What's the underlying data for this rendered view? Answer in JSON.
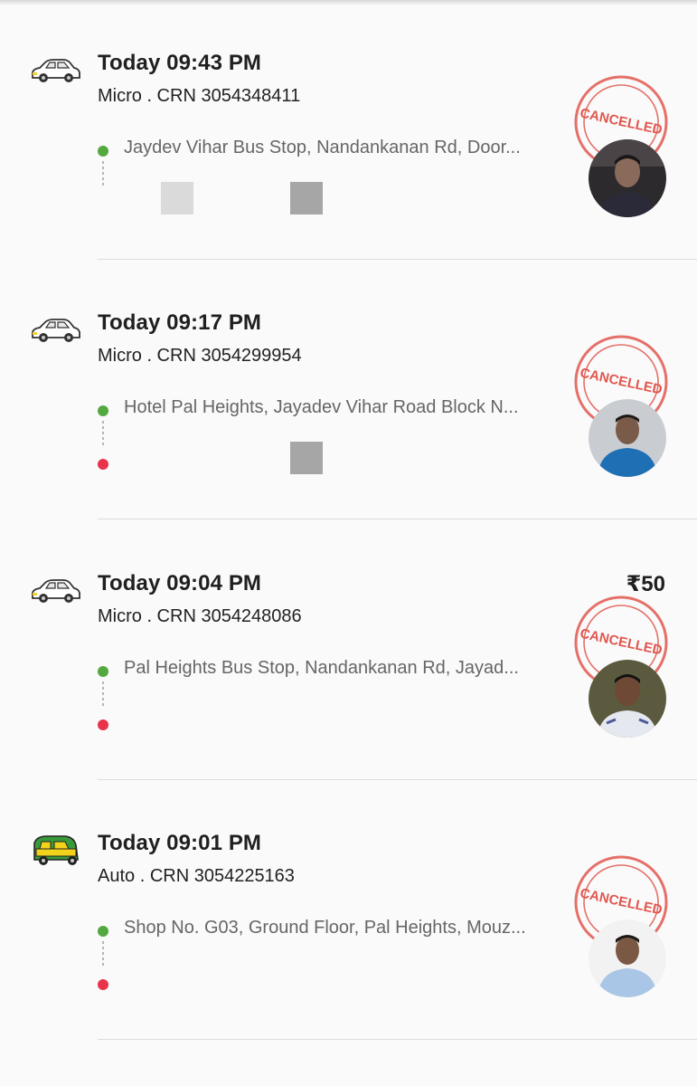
{
  "rides": [
    {
      "vehicle_icon": "car-icon",
      "time": "Today 09:43 PM",
      "category_crn": "Micro . CRN 3054348411",
      "pickup": "Jaydev Vihar Bus Stop, Nandankanan Rd, Door...",
      "fare": "",
      "status_stamp": "CANCELLED",
      "has_drop": false
    },
    {
      "vehicle_icon": "car-icon",
      "time": "Today 09:17 PM",
      "category_crn": "Micro . CRN 3054299954",
      "pickup": "Hotel Pal Heights, Jayadev Vihar Road Block N...",
      "fare": "",
      "status_stamp": "CANCELLED",
      "has_drop": true
    },
    {
      "vehicle_icon": "car-icon",
      "time": "Today 09:04 PM",
      "category_crn": "Micro . CRN 3054248086",
      "pickup": "Pal Heights Bus Stop, Nandankanan Rd, Jayad...",
      "fare": "₹50",
      "status_stamp": "CANCELLED",
      "has_drop": true
    },
    {
      "vehicle_icon": "auto-rickshaw-icon",
      "time": "Today 09:01 PM",
      "category_crn": "Auto . CRN 3054225163",
      "pickup": "Shop No. G03, Ground Floor, Pal Heights, Mouz...",
      "fare": "",
      "status_stamp": "CANCELLED",
      "has_drop": true
    }
  ],
  "colors": {
    "pickup_dot": "#53a93f",
    "drop_dot": "#e8334a",
    "stamp_red": "#e0574f",
    "auto_green": "#3a9a3a",
    "auto_yellow": "#f3d21b"
  }
}
